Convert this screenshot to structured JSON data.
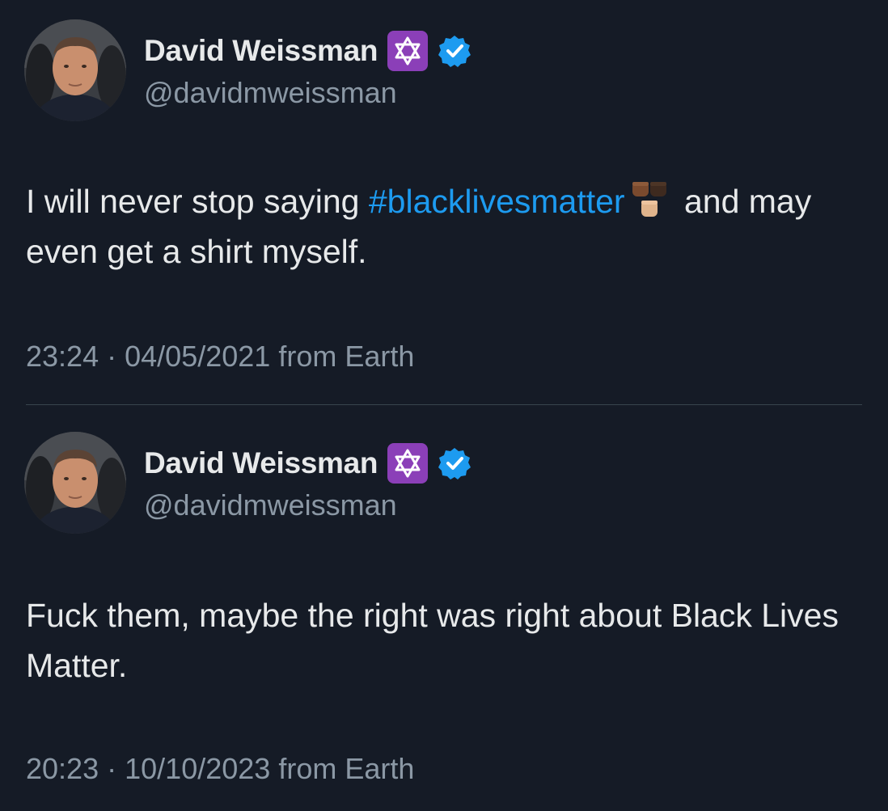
{
  "tweets": [
    {
      "display_name": "David Weissman",
      "handle": "@davidmweissman",
      "badge_icon": "star-of-david-icon",
      "verified_icon": "verified-badge-icon",
      "text_before": "I will never stop saying ",
      "hashtag": "#blacklivesmatter",
      "emoji": "raised-fists-icon",
      "text_after": " and may even get a shirt myself.",
      "time": "23:24",
      "separator": "·",
      "date": "04/05/2021",
      "source": "from Earth"
    },
    {
      "display_name": "David Weissman",
      "handle": "@davidmweissman",
      "badge_icon": "star-of-david-icon",
      "verified_icon": "verified-badge-icon",
      "text": "Fuck them, maybe the right was right about Black Lives Matter.",
      "time": "20:23",
      "separator": "·",
      "date": "10/10/2023",
      "source": "from Earth"
    }
  ],
  "colors": {
    "background": "#151b26",
    "text": "#e7e9ea",
    "secondary": "#8b98a5",
    "link": "#1d9bf0",
    "badge": "#8b3fb8",
    "verified": "#1d9bf0"
  }
}
